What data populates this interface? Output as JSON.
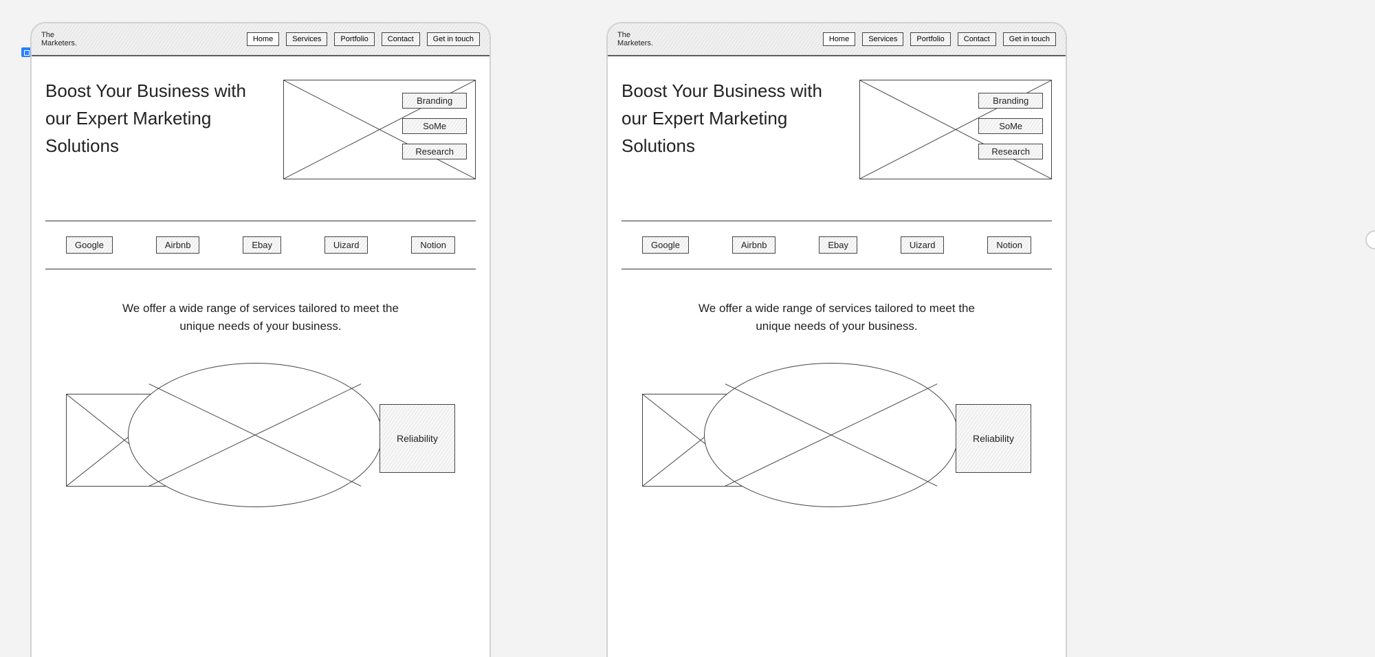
{
  "brand": {
    "line1": "The",
    "line2": "Marketers."
  },
  "nav": {
    "items": [
      {
        "label": "Home",
        "hatch": false
      },
      {
        "label": "Services",
        "hatch": true
      },
      {
        "label": "Portfolio",
        "hatch": true
      },
      {
        "label": "Contact",
        "hatch": true
      },
      {
        "label": "Get in touch",
        "hatch": true
      }
    ]
  },
  "hero": {
    "title": "Boost Your Business with our Expert Marketing Solutions",
    "tags": [
      "Branding",
      "SoMe",
      "Research"
    ]
  },
  "clients": [
    "Google",
    "Airbnb",
    "Ebay",
    "Uizard",
    "Notion"
  ],
  "services_tagline": "We offer a wide range of services tailored to meet the unique needs of your business.",
  "feature_card": "Reliability"
}
